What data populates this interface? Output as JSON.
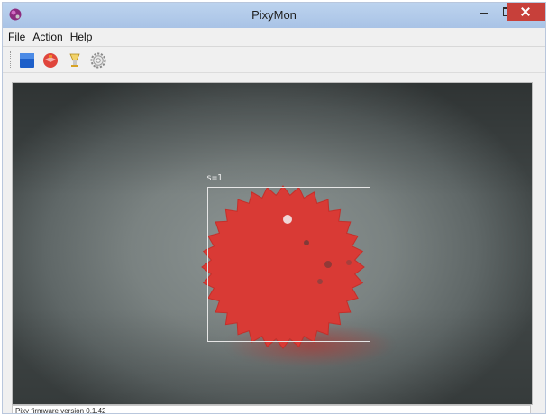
{
  "window": {
    "title": "PixyMon"
  },
  "menu": {
    "items": [
      "File",
      "Action",
      "Help"
    ]
  },
  "toolbar": {
    "icons": [
      "stop-icon",
      "run-icon",
      "lamp-icon",
      "gear-icon"
    ]
  },
  "video": {
    "detection_label": "s=1"
  },
  "status": {
    "text": "Pixy firmware version 0.1.42"
  },
  "colors": {
    "titlebar": "#bcd3ee",
    "close_button": "#c7403a",
    "ball_red": "#d93a35",
    "bbox": "#e6e6e6"
  }
}
